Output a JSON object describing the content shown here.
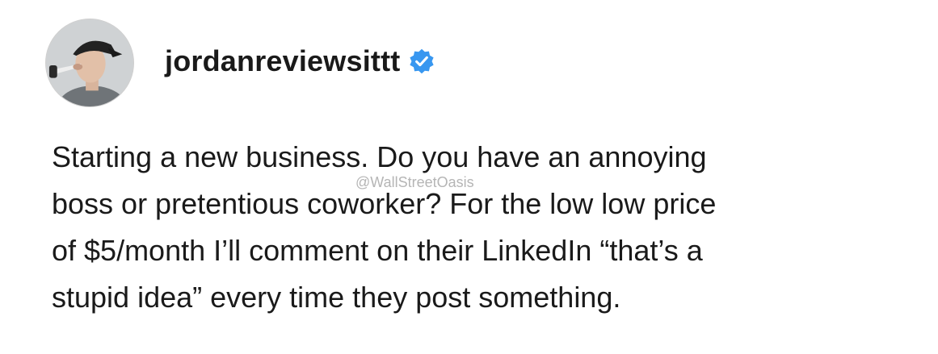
{
  "post": {
    "username": "jordanreviewsittt",
    "verified_icon": "verified-badge-icon",
    "avatar_icon": "avatar-photo",
    "text": "Starting a new business. Do you have an annoying\nboss or pretentious coworker? For the low low price\nof $5/month I’ll comment on their LinkedIn “that’s a\nstupid idea” every time they post something.",
    "watermark": "@WallStreetOasis"
  },
  "colors": {
    "verified": "#3897f0",
    "text": "#1a1a1a",
    "background": "#ffffff"
  }
}
